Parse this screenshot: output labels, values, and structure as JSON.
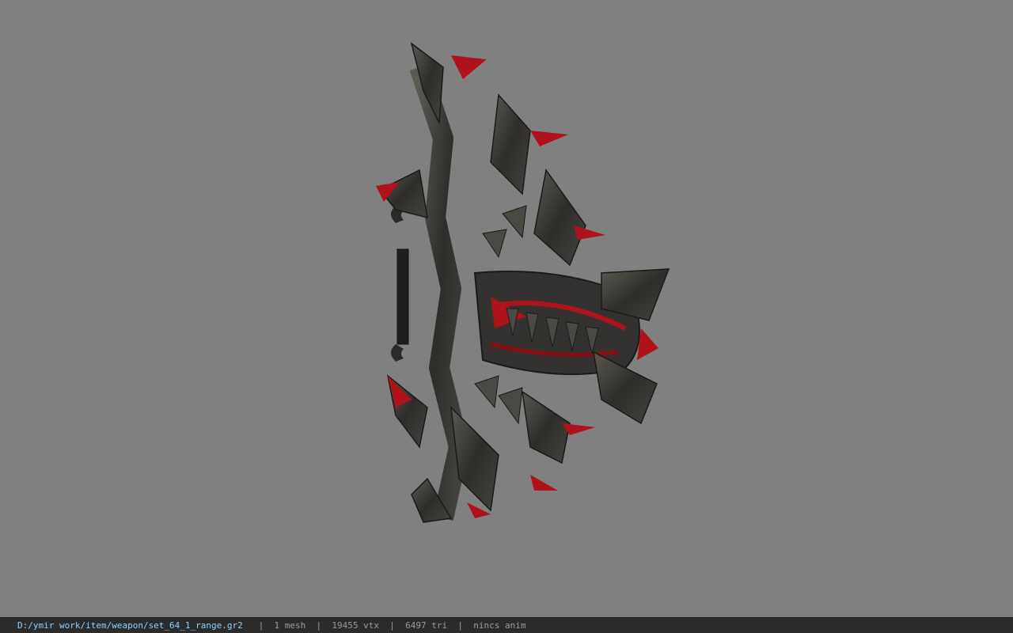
{
  "viewport": {
    "background": "#808080",
    "model": {
      "subject": "bow-weapon-model",
      "primary_color": "#3a3a36",
      "accent_color": "#b0121c"
    }
  },
  "status_bar": {
    "file_path": "D:/ymir work/item/weapon/set_64_1_range.gr2",
    "mesh_count": "1 mesh",
    "vertex_count": "19455 vtx",
    "triangle_count": "6497 tri",
    "anim_status": "nincs anim",
    "separator": "|",
    "path_color": "#8fd0ff"
  }
}
